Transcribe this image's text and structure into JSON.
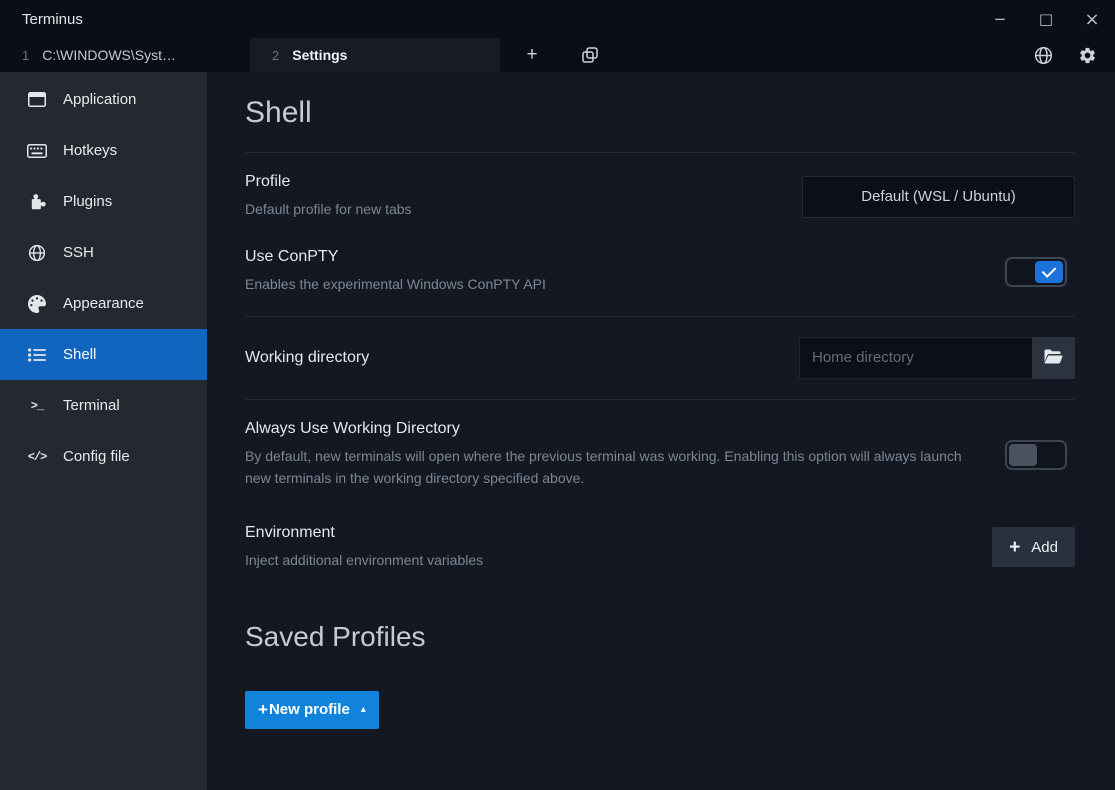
{
  "window": {
    "title": "Terminus"
  },
  "titlebar": {
    "minimize": "−",
    "maximize": "□",
    "close": "×"
  },
  "tabbar": {
    "tabs": [
      {
        "index": "1",
        "label": "C:\\WINDOWS\\Syst…"
      },
      {
        "index": "2",
        "label": "Settings"
      }
    ],
    "new_tab": "+"
  },
  "sidebar": {
    "items": [
      {
        "label": "Application",
        "icon": "window-icon"
      },
      {
        "label": "Hotkeys",
        "icon": "keyboard-icon"
      },
      {
        "label": "Plugins",
        "icon": "puzzle-icon"
      },
      {
        "label": "SSH",
        "icon": "globe-icon"
      },
      {
        "label": "Appearance",
        "icon": "palette-icon"
      },
      {
        "label": "Shell",
        "icon": "list-icon",
        "active": true
      },
      {
        "label": "Terminal",
        "icon": "terminal-icon",
        "glyph": ">_"
      },
      {
        "label": "Config file",
        "icon": "code-icon",
        "glyph": "</>"
      }
    ]
  },
  "content": {
    "heading": "Shell",
    "rows": {
      "profile": {
        "label": "Profile",
        "description": "Default profile for new tabs",
        "value": "Default (WSL / Ubuntu)"
      },
      "conpty": {
        "label": "Use ConPTY",
        "description": "Enables the experimental Windows ConPTY API",
        "checked": true
      },
      "working_directory": {
        "label": "Working directory",
        "placeholder": "Home directory"
      },
      "always_working_directory": {
        "label": "Always Use Working Directory",
        "description": "By default, new terminals will open where the previous terminal was working. Enabling this option will always launch new terminals in the working directory specified above.",
        "checked": false
      },
      "environment": {
        "label": "Environment",
        "description": "Inject additional environment variables",
        "plus": "+",
        "add_label": "Add"
      }
    },
    "saved_profiles": {
      "heading": "Saved Profiles",
      "plus": "+",
      "new_profile_label": "New profile",
      "caret": "▴"
    }
  },
  "colors": {
    "accent_blue": "#1283da",
    "sidebar_active_blue": "#1065c0",
    "toggle_checked_blue": "#1b72d8",
    "background": "#141822",
    "titlebar_background": "#0b0e17",
    "sidebar_background": "#24282f"
  }
}
